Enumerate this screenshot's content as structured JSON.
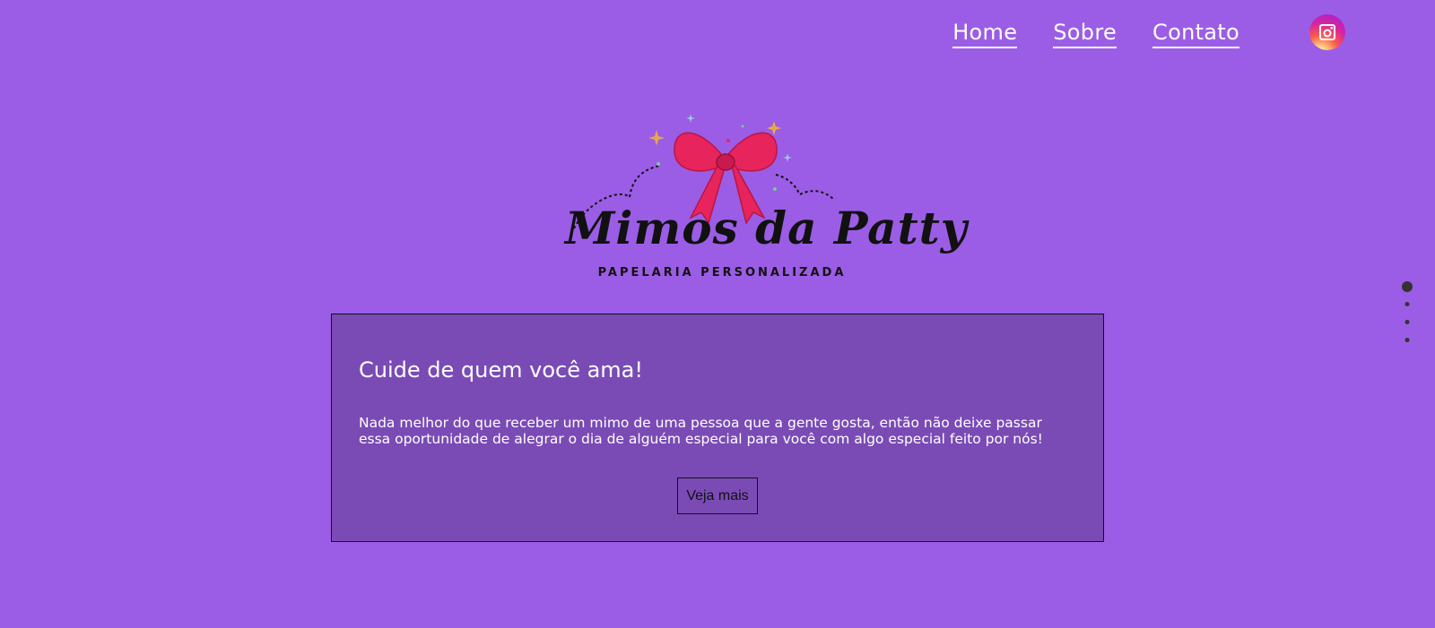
{
  "nav": {
    "items": [
      {
        "label": "Home"
      },
      {
        "label": "Sobre"
      },
      {
        "label": "Contato"
      }
    ],
    "instagram_icon": "instagram-icon"
  },
  "logo": {
    "script_text": "Mimos da Patty",
    "subtitle": "PAPELARIA PERSONALIZADA",
    "bow_color": "#e8245c"
  },
  "hero": {
    "title": "Cuide de quem você ama!",
    "text": "Nada melhor do que receber um mimo de uma pessoa que a gente gosta, então não deixe passar essa oportunidade de alegrar o dia de alguém especial para você com algo especial feito por nós!",
    "button_label": "Veja mais"
  },
  "pagination": {
    "count": 4,
    "active_index": 0
  },
  "colors": {
    "background": "#9b5de5",
    "card": "#7a4bb5",
    "text": "#ffffff"
  }
}
